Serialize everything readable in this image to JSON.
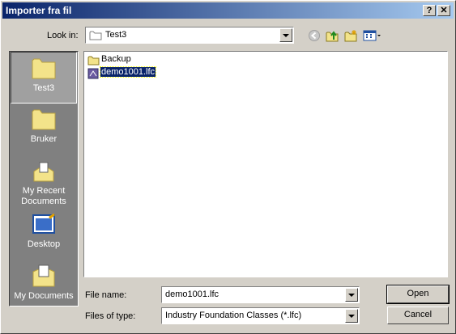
{
  "window": {
    "title": "Importer fra fil"
  },
  "titlebar": {
    "help_label": "?",
    "close_label": "✕"
  },
  "lookin": {
    "label": "Look in:",
    "value": "Test3"
  },
  "places": [
    {
      "label": "Test3",
      "icon": "folder-icon"
    },
    {
      "label": "Bruker",
      "icon": "folder-icon"
    },
    {
      "label": "My Recent Documents",
      "icon": "recent-documents-icon"
    },
    {
      "label": "Desktop",
      "icon": "desktop-icon"
    },
    {
      "label": "My Documents",
      "icon": "my-documents-icon"
    }
  ],
  "files": [
    {
      "name": "Backup",
      "type": "folder"
    },
    {
      "name": "demo1001.lfc",
      "type": "file",
      "selected": true
    }
  ],
  "filename": {
    "label": "File name:",
    "value": "demo1001.lfc"
  },
  "filetype": {
    "label": "Files of type:",
    "value": "Industry Foundation Classes (*.lfc)"
  },
  "buttons": {
    "open": "Open",
    "cancel": "Cancel"
  },
  "colors": {
    "title_start": "#0a246a",
    "title_end": "#a6caf0",
    "selection": "#0a246a",
    "face": "#d4d0c8"
  }
}
